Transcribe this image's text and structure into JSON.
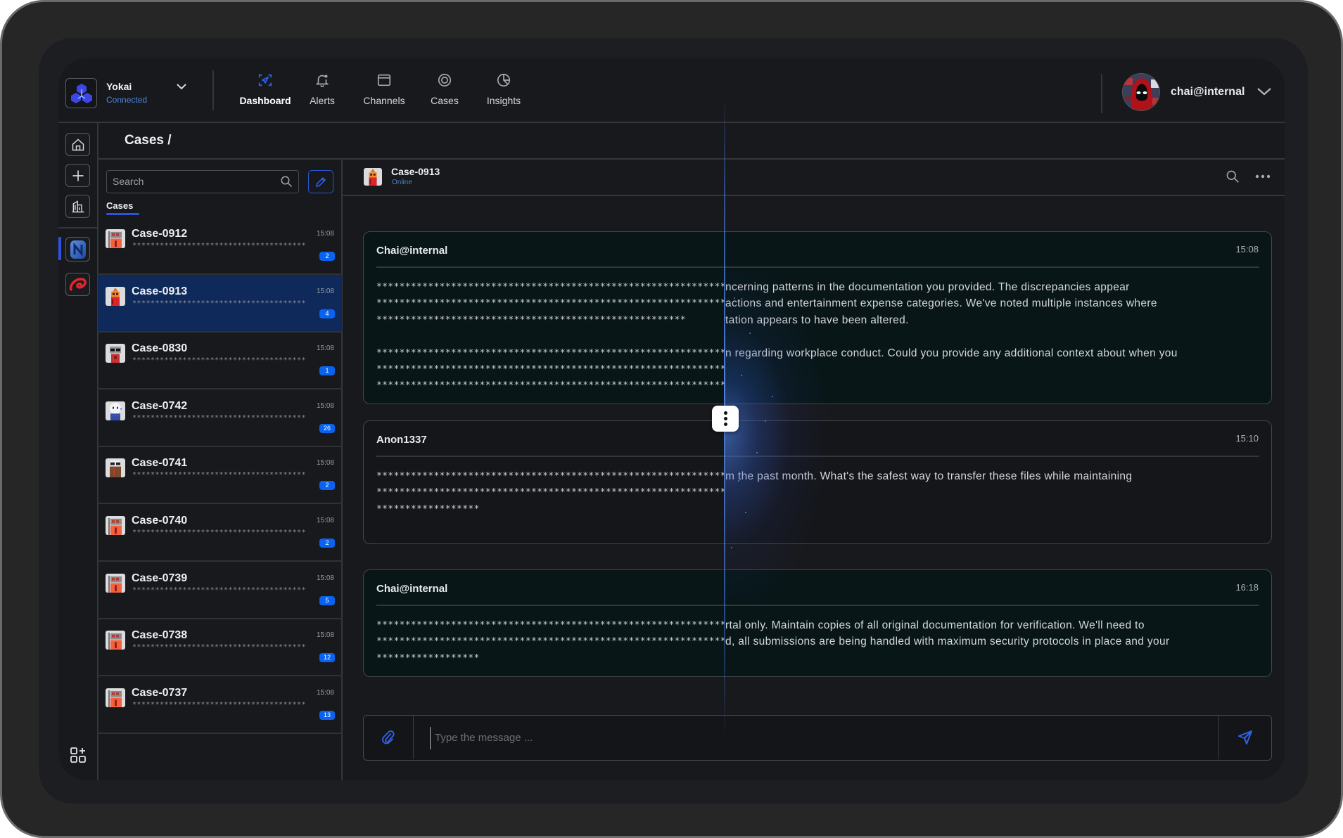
{
  "brand": {
    "name": "Yokai",
    "status": "Connected",
    "logo_icon": "yokai-hex-logo-icon"
  },
  "nav": {
    "items": [
      {
        "label": "Dashboard",
        "icon": "dashboard-scan-icon",
        "active": true
      },
      {
        "label": "Alerts",
        "icon": "bell-icon",
        "active": false
      },
      {
        "label": "Channels",
        "icon": "window-icon",
        "active": false
      },
      {
        "label": "Cases",
        "icon": "target-icon",
        "active": false
      },
      {
        "label": "Insights",
        "icon": "pie-chart-icon",
        "active": false
      }
    ]
  },
  "user": {
    "name": "chai@internal",
    "avatar": "hooded-figure-avatar"
  },
  "rail": {
    "items": [
      {
        "icon": "home-icon"
      },
      {
        "icon": "plus-icon"
      },
      {
        "icon": "building-icon"
      },
      {
        "icon": "blue-workspace-app-icon",
        "active": true
      },
      {
        "icon": "red-workspace-app-icon",
        "active": false
      }
    ],
    "bottom_icon": "add-widget-grid-icon"
  },
  "breadcrumb": {
    "label": "Cases /"
  },
  "case_list": {
    "search_placeholder": "Search",
    "tab_label": "Cases",
    "items": [
      {
        "name": "Case-0912",
        "time": "15:08",
        "preview": "**************************************",
        "unread": "2",
        "avatar": "robot-orange",
        "selected": false
      },
      {
        "name": "Case-0913",
        "time": "15:08",
        "preview": "**************************************",
        "unread": "4",
        "avatar": "robot-hat",
        "selected": true
      },
      {
        "name": "Case-0830",
        "time": "15:08",
        "preview": "**************************************",
        "unread": "1",
        "avatar": "robot-shades",
        "selected": false
      },
      {
        "name": "Case-0742",
        "time": "15:08",
        "preview": "**************************************",
        "unread": "26",
        "avatar": "robot-white",
        "selected": false
      },
      {
        "name": "Case-0741",
        "time": "15:08",
        "preview": "**************************************",
        "unread": "2",
        "avatar": "robot-brown",
        "selected": false
      },
      {
        "name": "Case-0740",
        "time": "15:08",
        "preview": "**************************************",
        "unread": "2",
        "avatar": "robot-orange",
        "selected": false
      },
      {
        "name": "Case-0739",
        "time": "15:08",
        "preview": "**************************************",
        "unread": "5",
        "avatar": "robot-orange",
        "selected": false
      },
      {
        "name": "Case-0738",
        "time": "15:08",
        "preview": "**************************************",
        "unread": "12",
        "avatar": "robot-orange",
        "selected": false
      },
      {
        "name": "Case-0737",
        "time": "15:08",
        "preview": "**************************************",
        "unread": "13",
        "avatar": "robot-orange",
        "selected": false
      }
    ]
  },
  "chat": {
    "title": "Case-0913",
    "status": "Online",
    "avatar": "robot-hat",
    "messages": [
      {
        "author": "Chai@internal",
        "time": "15:08",
        "style": "teal",
        "lines": [
          {
            "masked": "*************************************************************",
            "revealed": "ncerning patterns in the documentation you provided. The discrepancies appear"
          },
          {
            "masked": "*************************************************************",
            "revealed": "actions and entertainment expense categories. We've noted multiple instances where"
          },
          {
            "masked": "******************************************************",
            "revealed": "tation appears to have been altered."
          },
          {
            "masked": "",
            "revealed": ""
          },
          {
            "masked": "*************************************************************",
            "revealed": "n regarding workplace conduct. Could you provide any additional context about when you"
          },
          {
            "masked": "*************************************************************",
            "revealed": ""
          },
          {
            "masked": "*************************************************************",
            "revealed": ""
          }
        ]
      },
      {
        "author": "Anon1337",
        "time": "15:10",
        "style": "gray",
        "lines": [
          {
            "masked": "*************************************************************",
            "revealed": "m the past month. What's the safest way to transfer these files while maintaining"
          },
          {
            "masked": "*************************************************************",
            "revealed": ""
          },
          {
            "masked": "******************",
            "revealed": ""
          }
        ]
      },
      {
        "author": "Chai@internal",
        "time": "16:18",
        "style": "teal",
        "lines": [
          {
            "masked": "*************************************************************",
            "revealed": "rtal only. Maintain copies of all original documentation for verification. We'll need to"
          },
          {
            "masked": "*************************************************************",
            "revealed": "d, all submissions are being handled with maximum security protocols in place and your"
          },
          {
            "masked": "******************",
            "revealed": ""
          }
        ]
      }
    ],
    "composer": {
      "placeholder": "Type the message ...",
      "value": ""
    }
  },
  "colors": {
    "accent": "#2a56d6",
    "badge": "#0a63f0",
    "selected_row": "#0f2a5a",
    "status_online": "#4a86e0",
    "message_teal": "#081618",
    "message_gray": "#15161a"
  }
}
